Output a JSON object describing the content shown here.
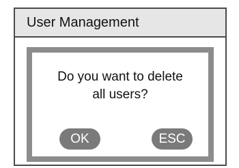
{
  "window": {
    "title": "User Management"
  },
  "dialog": {
    "message_line1": "Do you want to delete",
    "message_line2": "all users?",
    "ok_label": "OK",
    "esc_label": "ESC"
  },
  "colors": {
    "title_bar_bg": "#e6e6e6",
    "border": "#4a4a4a",
    "dialog_frame": "#8c8c8c",
    "button_bg": "#7a7a7a",
    "button_text": "#ffffff"
  }
}
